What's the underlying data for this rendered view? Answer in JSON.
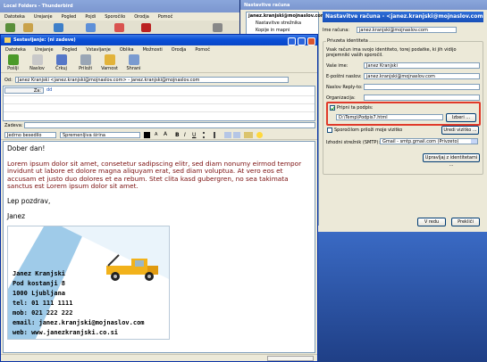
{
  "tb_main": {
    "title": "Local Folders - Thunderbird",
    "menu": [
      "Datoteka",
      "Urejanje",
      "Pogled",
      "Pojdi",
      "Sporočilo",
      "Orodja",
      "Pomoč"
    ]
  },
  "acct": {
    "title": "Nastavitve računa",
    "dialog_title": "Nastavitve računa - <janez.kranjski@mojnaslov.com",
    "tree": [
      "janez.kranjski@mojnaslov.com",
      "Nastavitve strežnika",
      "Kopije in mapni"
    ],
    "name_label": "Ime računa:",
    "name_value": "janez.kranjski@mojnaslov.com",
    "section": "Privzeta identiteta",
    "desc": "Vsak račun ima svojo identiteto, torej podatke, ki jih vidijo prejemniki vaših sporočil.",
    "fields": [
      {
        "label": "Vaše ime:",
        "value": "Janez Kranjski"
      },
      {
        "label": "E-poštni naslov:",
        "value": "janez.kranjski@mojnaslov.com"
      },
      {
        "label": "Naslov Reply-to:",
        "value": ""
      },
      {
        "label": "Organizacija:",
        "value": ""
      }
    ],
    "attach_check": "Pripni ta podpis:",
    "sig_path": "D:\\Temp\\Podpis7.html",
    "browse": "Izberi ...",
    "vcard_check": "Sporočilom priloži moje vizitko",
    "edit_card": "Uredi vizitko ...",
    "smtp_label": "Izhodni strežnik (SMTP):",
    "smtp_value": "Gmail - smtp.gmail.com (Privzeto)",
    "manage": "Upravljaj z identitetami ...",
    "ok": "V redu",
    "cancel": "Prekliči"
  },
  "compose": {
    "title": "Sestavljanje: (ni zadeve)",
    "menu": [
      "Datoteka",
      "Urejanje",
      "Pogled",
      "Vstavljanje",
      "Oblika",
      "Možnosti",
      "Orodja",
      "Pomoč"
    ],
    "toolbar": [
      "Pošlji",
      "Naslov",
      "Črkuj",
      "Priloži",
      "Varnost",
      "Shrani"
    ],
    "from_label": "Od:",
    "from_value": "Janez Kranjski <janez.kranjski@mojnaslov.com> - janez.kranjski@mojnaslov.com",
    "to_prefix": "Za:",
    "to_value": "dd",
    "subject_label": "Zadeva:",
    "format_style": "Jedrno besedilo",
    "format_font": "Spremenljiva širina",
    "fmt_buttons": [
      "B",
      "I",
      "U"
    ],
    "greeting": "Dober dan!",
    "body": "Lorem ipsum dolor sit amet, consetetur sadipscing elitr, sed diam nonumy eirmod tempor invidunt ut labore et dolore magna aliquyam erat, sed diam voluptua. At vero eos et accusam et justo duo dolores et ea rebum. Stet clita kasd gubergren, no sea takimata sanctus est Lorem ipsum dolor sit amet.",
    "closing": "Lep pozdrav,",
    "name": "Janez",
    "sig_lines": [
      "Janez Kranjski",
      "Pod kostanji 8",
      "1000 Ljubljana",
      "tel: 01 111 1111",
      "mob: 021 222 222",
      "email: janez.kranjski@mojnaslov.com",
      "web: www.janezkranjski.co.si"
    ]
  },
  "colors": {
    "xp_blue": "#0a4fd6",
    "highlight": "#e03a2a",
    "body_red": "#7a0e0e",
    "truck": "#f2b21b"
  }
}
